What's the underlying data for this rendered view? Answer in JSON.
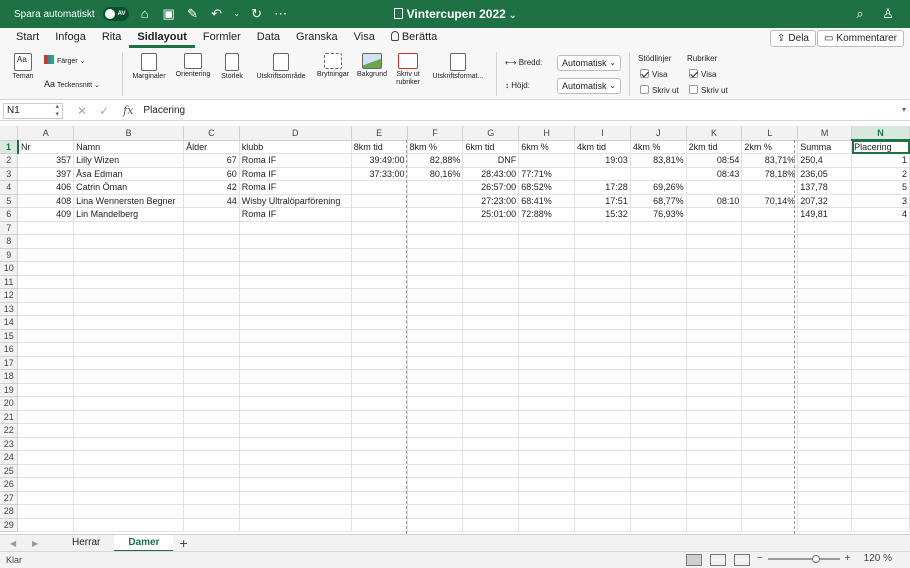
{
  "titlebar": {
    "autosave_label": "Spara automatiskt",
    "autosave_state": "AV",
    "doc_title": "Vintercupen 2022"
  },
  "ribbon_tabs": [
    "Start",
    "Infoga",
    "Rita",
    "Sidlayout",
    "Formler",
    "Data",
    "Granska",
    "Visa",
    "Berätta"
  ],
  "active_tab": "Sidlayout",
  "share_label": "Dela",
  "comments_label": "Kommentarer",
  "ribbon": {
    "teman": "Teman",
    "farger": "Färger",
    "teckensnitt": "Teckensnitt",
    "marginaler": "Marginaler",
    "orientering": "Orientering",
    "storlek": "Storlek",
    "utskriftsomrade": "Utskriftsområde",
    "brytningar": "Brytningar",
    "bakgrund": "Bakgrund",
    "skriv_ut_rubriker": "Skriv ut rubriker",
    "utskriftsformat": "Utskriftsformat...",
    "bredd_label": "Bredd:",
    "bredd_value": "Automatisk",
    "hojd_label": "Höjd:",
    "hojd_value": "Automatisk",
    "stodlinjer": "Stödlinjer",
    "rubriker": "Rubriker",
    "visa": "Visa",
    "skriv_ut": "Skriv ut"
  },
  "formula_bar": {
    "name_box": "N1",
    "fx": "fx",
    "value": "Placering"
  },
  "sheet": {
    "columns": [
      "A",
      "B",
      "C",
      "D",
      "E",
      "F",
      "G",
      "H",
      "I",
      "J",
      "K",
      "L",
      "M",
      "N"
    ],
    "rows": [
      [
        "Nr",
        "Namn",
        "Ålder",
        "klubb",
        "8km tid",
        "8km %",
        "6km tid",
        "6km %",
        "4km tid",
        "4km %",
        "2km tid",
        "2km %",
        "Summa",
        "Placering"
      ],
      [
        "357",
        "Lilly Wizen",
        "67",
        "Roma IF",
        "39:49:00",
        "82,88%",
        "DNF",
        "",
        "19:03",
        "83,81%",
        "08:54",
        "83,71%",
        "250,4",
        "1"
      ],
      [
        "397",
        "Åsa Edman",
        "60",
        "Roma IF",
        "37:33:00",
        "80,16%",
        "28:43:00",
        "77:71%",
        "",
        "",
        "08:43",
        "78,18%",
        "236,05",
        "2"
      ],
      [
        "406",
        "Catrin Öman",
        "42",
        "Roma IF",
        "",
        "",
        "26:57:00",
        "68:52%",
        "17:28",
        "69,26%",
        "",
        "",
        "137,78",
        "5"
      ],
      [
        "408",
        "Lina Wennersten Begner",
        "44",
        "Wisby Ultralöparförening",
        "",
        "",
        "27:23:00",
        "68:41%",
        "17:51",
        "68,77%",
        "08:10",
        "70,14%",
        "207,32",
        "3"
      ],
      [
        "409",
        "Lin Mandelberg",
        "",
        "Roma IF",
        "",
        "",
        "25:01:00",
        "72:88%",
        "15:32",
        "76,93%",
        "",
        "",
        "149,81",
        "4"
      ]
    ]
  },
  "sheets": [
    "Herrar",
    "Damer"
  ],
  "active_sheet": "Damer",
  "status": "Klar",
  "zoom": "120 %",
  "colors": {
    "accent": "#1e7145"
  }
}
